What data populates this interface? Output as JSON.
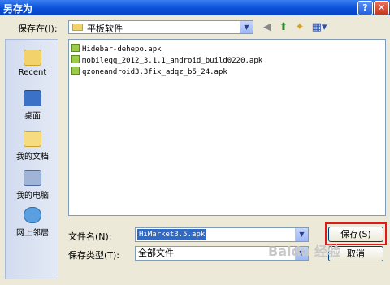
{
  "window": {
    "title": "另存为",
    "help": "?",
    "close": "✕"
  },
  "save_in": {
    "label": "保存在(I):",
    "value": "平板软件"
  },
  "places": [
    {
      "label": "Recent"
    },
    {
      "label": "桌面"
    },
    {
      "label": "我的文档"
    },
    {
      "label": "我的电脑"
    },
    {
      "label": "网上邻居"
    }
  ],
  "files": [
    "Hidebar-dehepo.apk",
    "mobileqq_2012_3.1.1_android_build0220.apk",
    "qzoneandroid3.3fix_adqz_b5_24.apk"
  ],
  "filename": {
    "label": "文件名(N):",
    "value": "HiMarket3.5.apk"
  },
  "filetype": {
    "label": "保存类型(T):",
    "value": "全部文件"
  },
  "buttons": {
    "save": "保存(S)",
    "cancel": "取消"
  },
  "watermark": "Baidu 经验"
}
